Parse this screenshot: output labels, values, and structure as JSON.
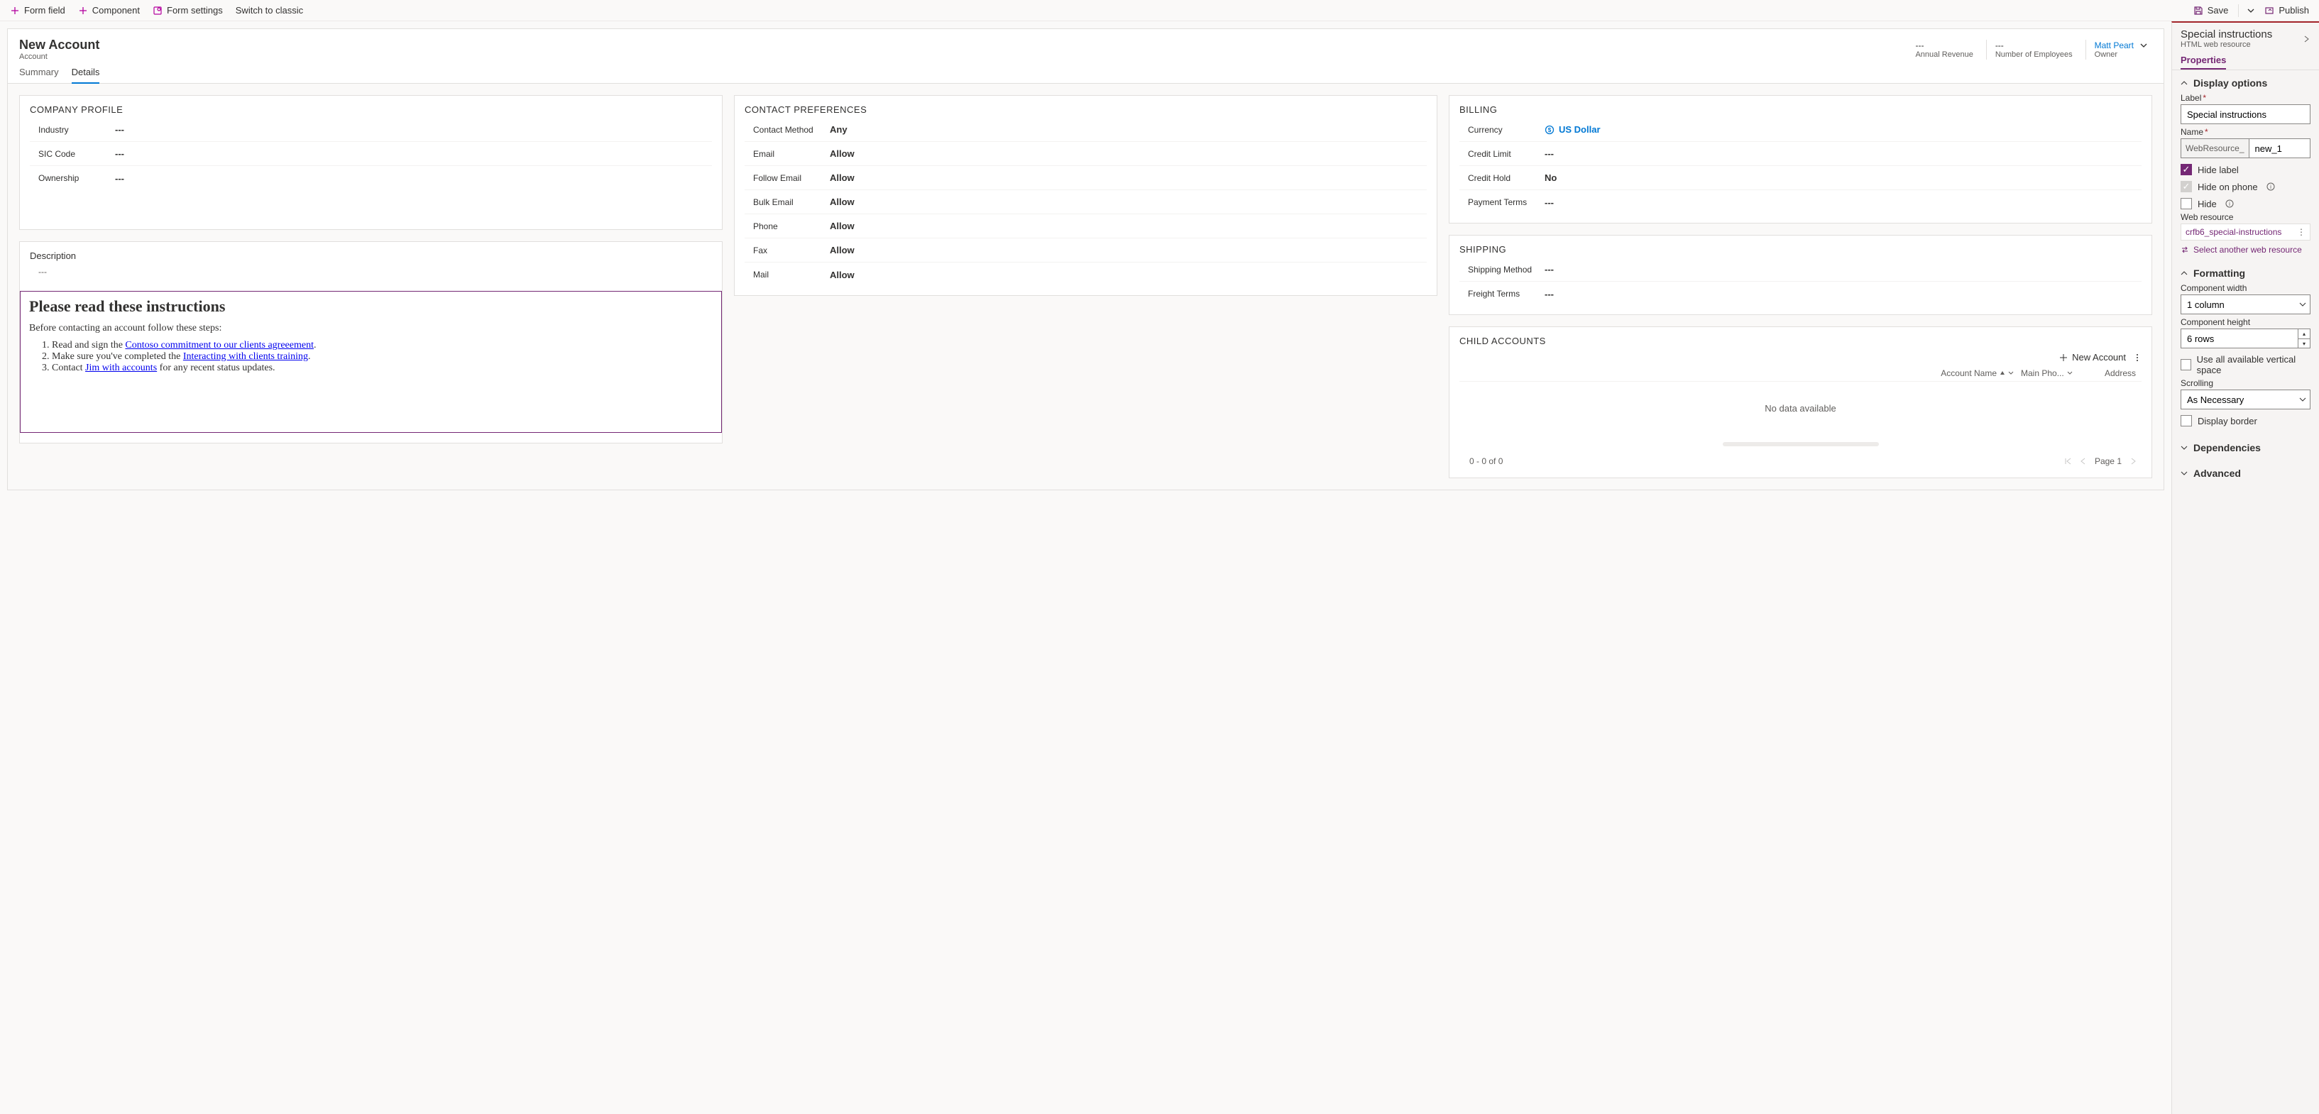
{
  "toolbar": {
    "form_field": "Form field",
    "component": "Component",
    "form_settings": "Form settings",
    "switch_classic": "Switch to classic",
    "save": "Save",
    "publish": "Publish"
  },
  "header": {
    "title": "New Account",
    "entity": "Account",
    "stats": {
      "annual_revenue": {
        "value": "---",
        "label": "Annual Revenue"
      },
      "num_employees": {
        "value": "---",
        "label": "Number of Employees"
      },
      "owner": {
        "value": "Matt Peart",
        "label": "Owner"
      }
    }
  },
  "tabs": {
    "summary": "Summary",
    "details": "Details"
  },
  "sections": {
    "company_profile": {
      "title": "COMPANY PROFILE",
      "industry": {
        "label": "Industry",
        "value": "---"
      },
      "sic": {
        "label": "SIC Code",
        "value": "---"
      },
      "ownership": {
        "label": "Ownership",
        "value": "---"
      }
    },
    "description": {
      "title": "Description",
      "value": "---"
    },
    "webresource": {
      "heading": "Please read these instructions",
      "intro": "Before contacting an account follow these steps:",
      "steps": {
        "s1a": "Read and sign the ",
        "s1b": "Contoso commitment to our clients agreeement",
        "s1c": ".",
        "s2a": "Make sure you've completed the ",
        "s2b": "Interacting with clients training",
        "s2c": ".",
        "s3a": "Contact ",
        "s3b": "Jim with accounts",
        "s3c": " for any recent status updates."
      }
    },
    "contact_prefs": {
      "title": "CONTACT PREFERENCES",
      "method": {
        "label": "Contact Method",
        "value": "Any"
      },
      "email": {
        "label": "Email",
        "value": "Allow"
      },
      "follow": {
        "label": "Follow Email",
        "value": "Allow"
      },
      "bulk": {
        "label": "Bulk Email",
        "value": "Allow"
      },
      "phone": {
        "label": "Phone",
        "value": "Allow"
      },
      "fax": {
        "label": "Fax",
        "value": "Allow"
      },
      "mail": {
        "label": "Mail",
        "value": "Allow"
      }
    },
    "billing": {
      "title": "BILLING",
      "currency": {
        "label": "Currency",
        "value": "US Dollar"
      },
      "credit_lim": {
        "label": "Credit Limit",
        "value": "---"
      },
      "credit_hold": {
        "label": "Credit Hold",
        "value": "No"
      },
      "pay_terms": {
        "label": "Payment Terms",
        "value": "---"
      }
    },
    "shipping": {
      "title": "SHIPPING",
      "method": {
        "label": "Shipping Method",
        "value": "---"
      },
      "freight": {
        "label": "Freight Terms",
        "value": "---"
      }
    },
    "child_accts": {
      "title": "CHILD ACCOUNTS",
      "new_btn": "New Account",
      "cols": {
        "name": "Account Name",
        "phone": "Main Pho...",
        "address": "Address"
      },
      "empty": "No data available",
      "status": "0 - 0 of 0",
      "pager": "Page 1"
    }
  },
  "sidepanel": {
    "title": "Special instructions",
    "subtitle": "HTML web resource",
    "tab": "Properties",
    "groups": {
      "display": "Display options",
      "formatting": "Formatting",
      "dependencies": "Dependencies",
      "advanced": "Advanced"
    },
    "fields": {
      "label_lbl": "Label",
      "label_value": "Special instructions",
      "name_lbl": "Name",
      "name_prefix": "WebResource_",
      "name_value": "new_1",
      "hide_label": "Hide label",
      "hide_phone": "Hide on phone",
      "hide": "Hide",
      "web_resource_lbl": "Web resource",
      "web_resource_value": "crfb6_special-instructions",
      "select_another": "Select another web resource",
      "comp_width_lbl": "Component width",
      "comp_width_value": "1 column",
      "comp_height_lbl": "Component height",
      "comp_height_value": "6 rows",
      "use_all_vspace": "Use all available vertical space",
      "scrolling_lbl": "Scrolling",
      "scrolling_value": "As Necessary",
      "display_border": "Display border"
    }
  }
}
